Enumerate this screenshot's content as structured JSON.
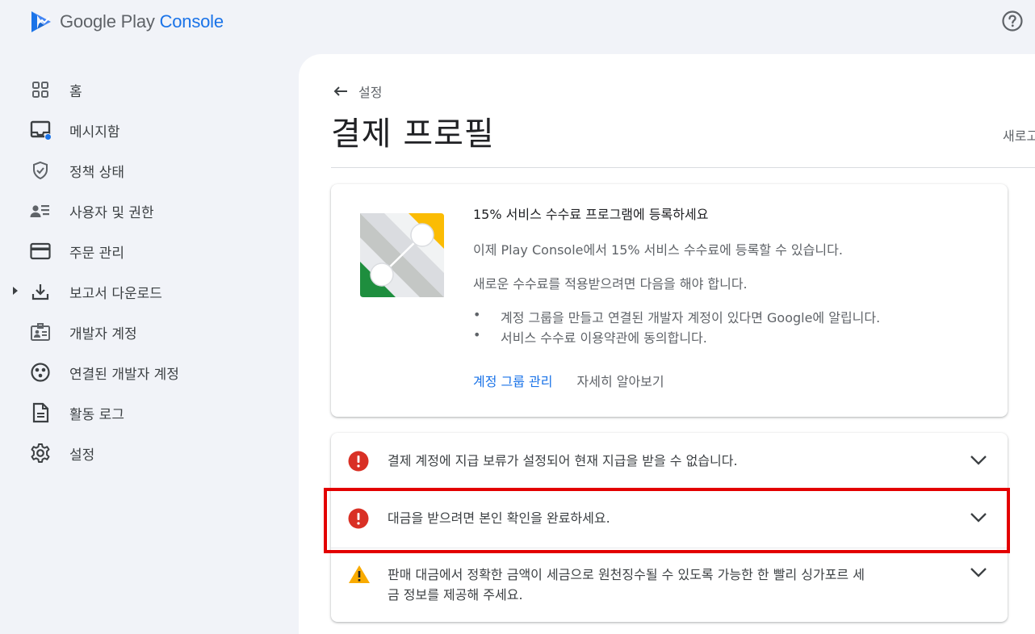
{
  "header": {
    "logo_google_play": "Google Play ",
    "logo_console": "Console",
    "help_icon": "help-circle-icon"
  },
  "sidebar": {
    "items": [
      {
        "label": "홈",
        "icon": "grid-icon"
      },
      {
        "label": "메시지함",
        "icon": "inbox-icon",
        "badge": "blue-dot"
      },
      {
        "label": "정책 상태",
        "icon": "shield-check-icon"
      },
      {
        "label": "사용자 및 권한",
        "icon": "users-list-icon"
      },
      {
        "label": "주문 관리",
        "icon": "credit-card-icon"
      },
      {
        "label": "보고서 다운로드",
        "icon": "download-icon",
        "expandable": true
      },
      {
        "label": "개발자 계정",
        "icon": "id-badge-icon"
      },
      {
        "label": "연결된 개발자 계정",
        "icon": "linked-circles-icon"
      },
      {
        "label": "활동 로그",
        "icon": "document-icon"
      },
      {
        "label": "설정",
        "icon": "gear-icon"
      }
    ]
  },
  "main": {
    "breadcrumb": "설정",
    "title": "결제 프로필",
    "refresh_label": "새로고",
    "promo": {
      "title": "15% 서비스 수수료 프로그램에 등록하세요",
      "p1": "이제 Play Console에서 15% 서비스 수수료에 등록할 수 있습니다.",
      "p2": "새로운 수수료를 적용받으려면 다음을 해야 합니다.",
      "bullets": [
        "계정 그룹을 만들고 연결된 개발자 계정이 있다면 Google에 알립니다.",
        "서비스 수수료 이용약관에 동의합니다."
      ],
      "link_primary": "계정 그룹 관리",
      "link_secondary": "자세히 알아보기"
    },
    "alerts": [
      {
        "type": "error",
        "text": "결제 계정에 지급 보류가 설정되어 현재 지급을 받을 수 없습니다."
      },
      {
        "type": "error",
        "text": "대금을 받으려면 본인 확인을 완료하세요."
      },
      {
        "type": "warning",
        "text_line1": "판매 대금에서 정확한 금액이 세금으로 원천징수될 수 있도록 가능한 한 빨리 싱가포르 세",
        "text_line2": "금 정보를 제공해 주세요."
      }
    ]
  },
  "colors": {
    "accent": "#1a73e8",
    "error": "#d93025",
    "warning": "#f9ab00",
    "highlight": "#e30000"
  }
}
